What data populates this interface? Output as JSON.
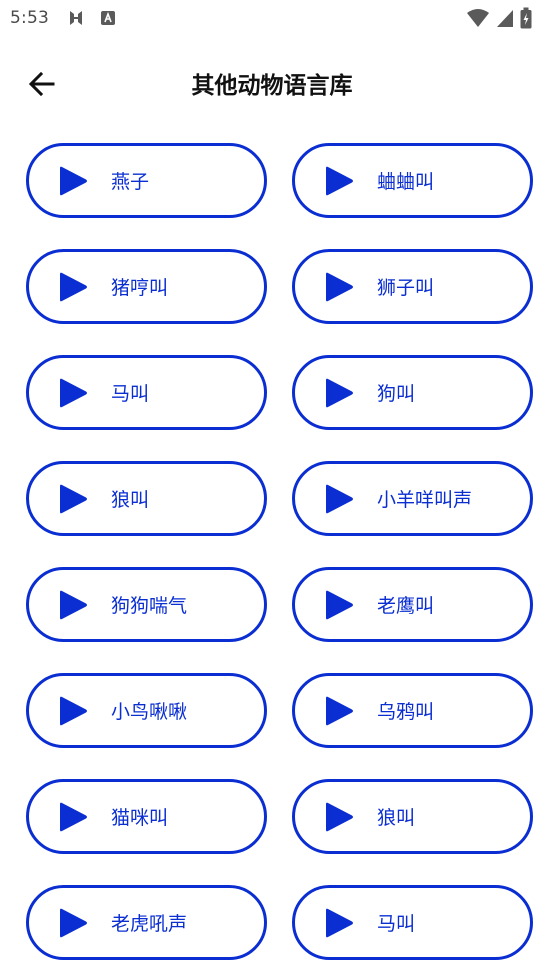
{
  "status_bar": {
    "time": "5:53",
    "left_icons": [
      "sync-icon",
      "font-a-icon"
    ],
    "right_icons": [
      "wifi-icon",
      "signal-icon",
      "battery-charging-icon"
    ]
  },
  "app_bar": {
    "title": "其他动物语言库",
    "back_icon": "arrow-left-icon"
  },
  "sounds": [
    {
      "label": "燕子"
    },
    {
      "label": "蛐蛐叫"
    },
    {
      "label": "猪哼叫"
    },
    {
      "label": "狮子叫"
    },
    {
      "label": "马叫"
    },
    {
      "label": "狗叫"
    },
    {
      "label": "狼叫"
    },
    {
      "label": "小羊咩叫声"
    },
    {
      "label": "狗狗喘气"
    },
    {
      "label": "老鹰叫"
    },
    {
      "label": "小鸟啾啾"
    },
    {
      "label": "乌鸦叫"
    },
    {
      "label": "猫咪叫"
    },
    {
      "label": "狼叫"
    },
    {
      "label": "老虎吼声"
    },
    {
      "label": "马叫"
    }
  ],
  "colors": {
    "accent": "#0a2ed2",
    "title": "#111111",
    "status": "#4a4a4a",
    "background": "#ffffff"
  }
}
